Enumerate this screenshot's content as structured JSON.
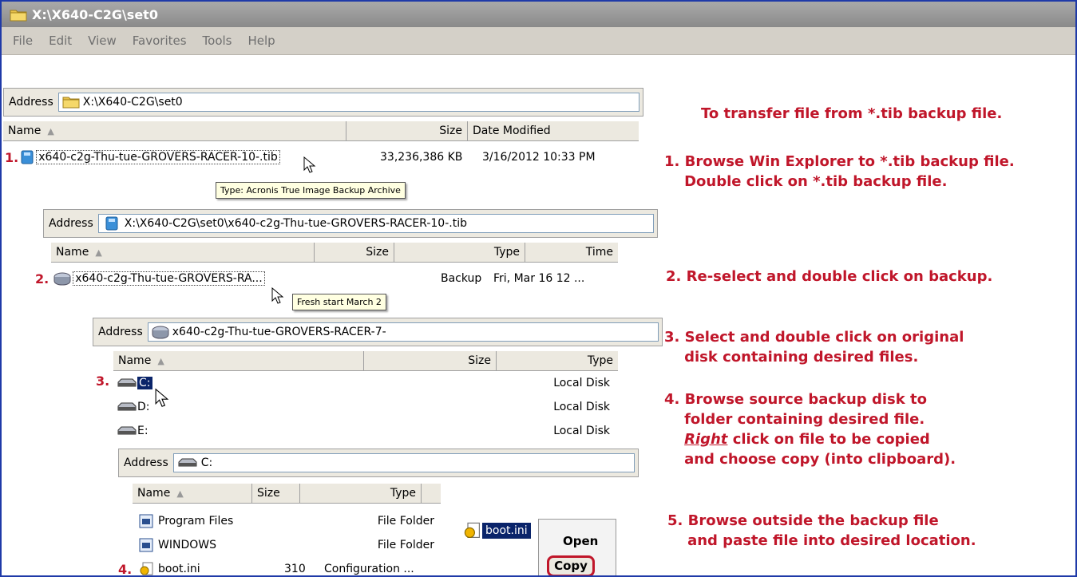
{
  "window": {
    "title": "X:\\X640-C2G\\set0"
  },
  "menu": [
    "File",
    "Edit",
    "View",
    "Favorites",
    "Tools",
    "Help"
  ],
  "address_label": "Address",
  "win1": {
    "address": "X:\\X640-C2G\\set0",
    "columns": {
      "name": "Name",
      "size": "Size",
      "date": "Date Modified"
    },
    "file": {
      "step": "1.",
      "name": "x640-c2g-Thu-tue-GROVERS-RACER-10-.tib",
      "size": "33,236,386 KB",
      "date": "3/16/2012 10:33 PM"
    },
    "tooltip": "Type: Acronis True Image Backup Archive"
  },
  "win2": {
    "address": "X:\\X640-C2G\\set0\\x640-c2g-Thu-tue-GROVERS-RACER-10-.tib",
    "columns": {
      "name": "Name",
      "size": "Size",
      "type": "Type",
      "time": "Time"
    },
    "item": {
      "step": "2.",
      "name": "x640-c2g-Thu-tue-GROVERS-RA...",
      "type": "Backup",
      "time": "Fri, Mar 16 12 ..."
    },
    "tooltip": "Fresh start March 2"
  },
  "win3": {
    "address": "x640-c2g-Thu-tue-GROVERS-RACER-7-",
    "columns": {
      "name": "Name",
      "size": "Size",
      "type": "Type"
    },
    "step": "3.",
    "disks": [
      {
        "name": "C:",
        "type": "Local Disk"
      },
      {
        "name": "D:",
        "type": "Local Disk"
      },
      {
        "name": "E:",
        "type": "Local Disk"
      }
    ]
  },
  "win4": {
    "address": "C:",
    "columns": {
      "name": "Name",
      "size": "Size",
      "type": "Type"
    },
    "step": "4.",
    "items": [
      {
        "name": "Program Files",
        "size": "",
        "type": "File Folder"
      },
      {
        "name": "WINDOWS",
        "size": "",
        "type": "File Folder"
      },
      {
        "name": "boot.ini",
        "size": "310",
        "type": "Configuration ..."
      }
    ]
  },
  "drag_item": "boot.ini",
  "context_menu": {
    "open": "Open",
    "copy": "Copy"
  },
  "instructions": {
    "title": "To transfer file from *.tib backup file.",
    "step1": "1. Browse Win Explorer to *.tib backup file.\n    Double click on *.tib backup file.",
    "step2": "2. Re-select and double click on backup.",
    "step3": "3. Select and double click on original\n    disk containing desired files.",
    "step4a": "4. Browse source backup disk to\n    folder containing desired file.\n    ",
    "step4_right": "Right",
    "step4b": " click on file to be copied\n    and choose copy (into clipboard).",
    "step5": "5. Browse outside the backup file\n    and paste file into desired location."
  },
  "colors": {
    "accent_red": "#c0162a",
    "frame_blue": "#1f3aa8",
    "selection": "#0a246a"
  }
}
